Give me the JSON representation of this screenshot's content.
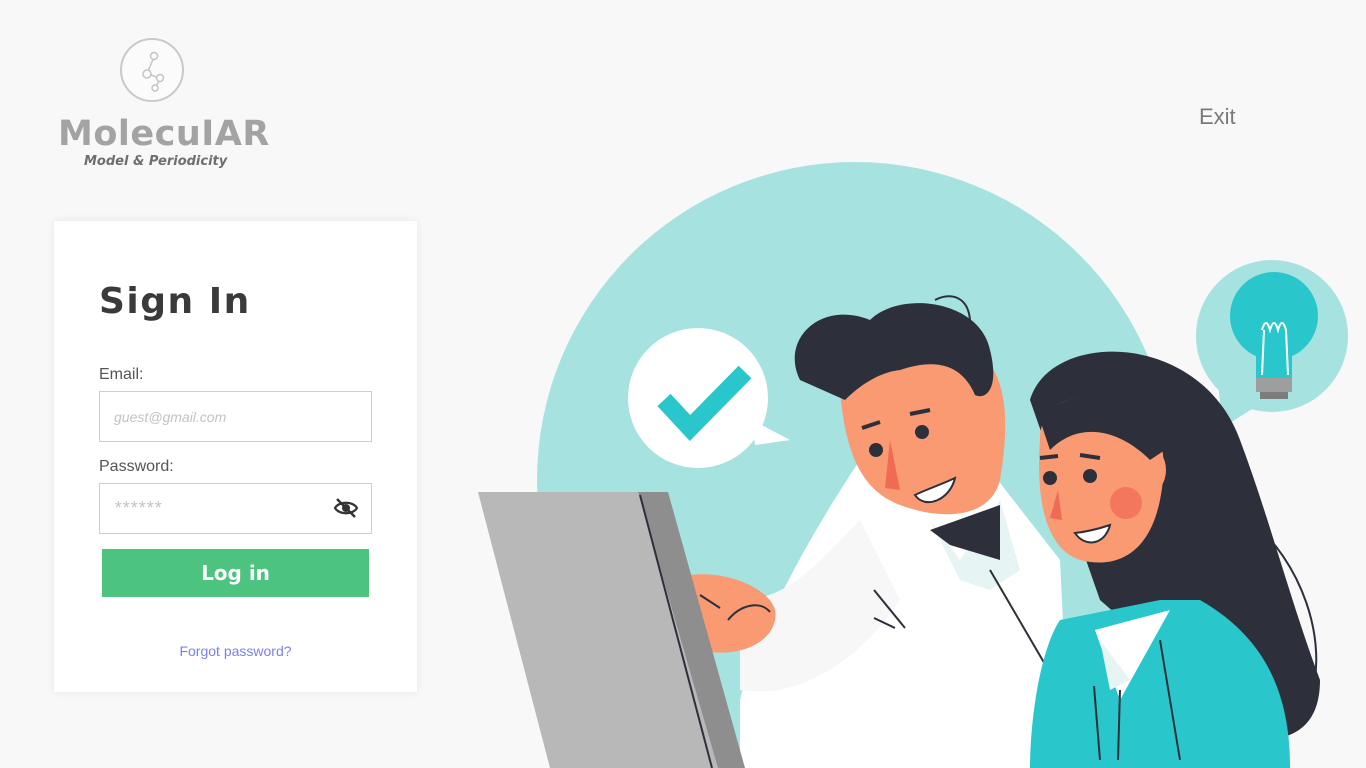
{
  "brand": {
    "name": "MolecuIAR",
    "tagline": "Model & Periodicity"
  },
  "header": {
    "exit_label": "Exit"
  },
  "signin": {
    "title": "Sign In",
    "email_label": "Email:",
    "email_placeholder": "guest@gmail.com",
    "email_value": "",
    "password_label": "Password:",
    "password_placeholder": "******",
    "password_value": "",
    "password_toggle_icon": "eye-slash-icon",
    "login_label": "Log in",
    "forgot_label": "Forgot password?"
  },
  "colors": {
    "background": "#f8f8f8",
    "login_button": "#4cc47f",
    "forgot_link": "#7b7ff0",
    "illustration_circle": "#a6e3e0",
    "accent_teal": "#29c7cc"
  }
}
